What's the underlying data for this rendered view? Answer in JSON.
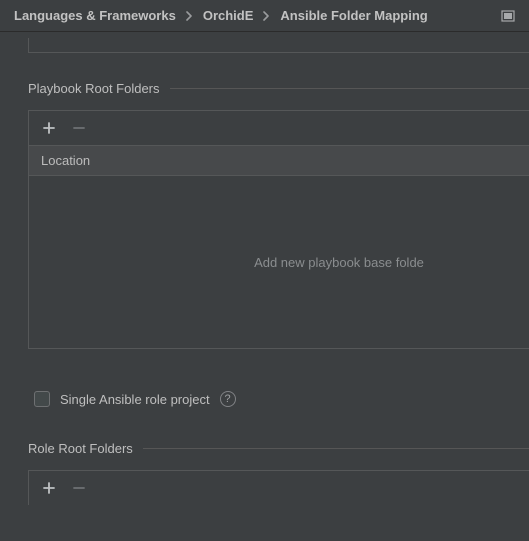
{
  "breadcrumb": {
    "items": [
      "Languages & Frameworks",
      "OrchidE",
      "Ansible Folder Mapping"
    ]
  },
  "sections": {
    "playbook": {
      "title": "Playbook Root Folders",
      "column_header": "Location",
      "empty_text": "Add new playbook base folde"
    },
    "role_checkbox": {
      "label": "Single Ansible role project"
    },
    "role": {
      "title": "Role Root Folders"
    }
  }
}
